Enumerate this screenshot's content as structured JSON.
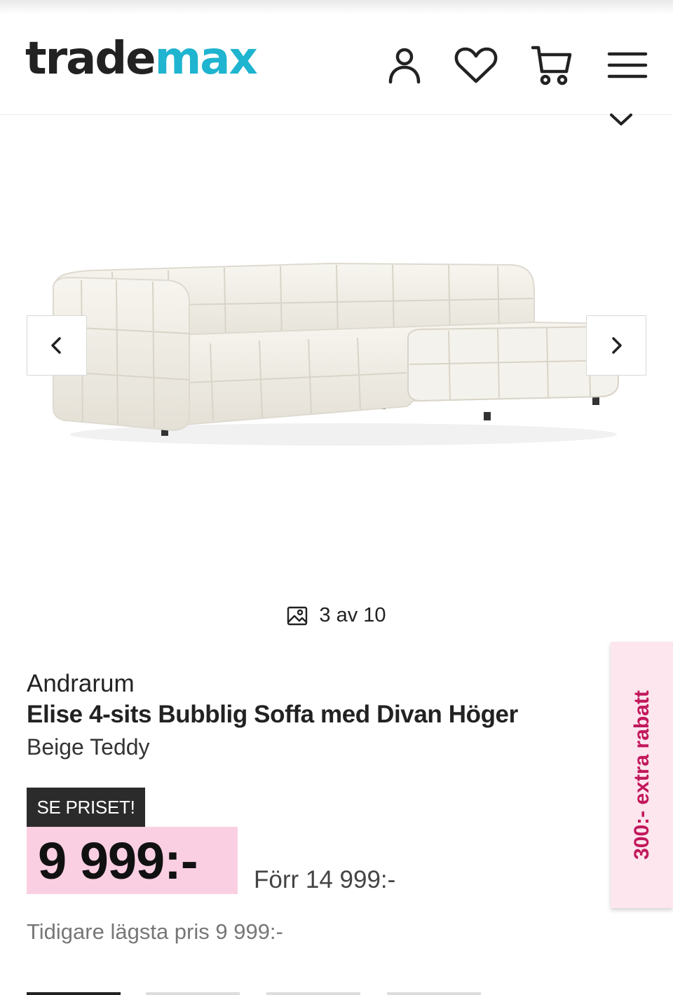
{
  "header": {
    "logo_part1": "trade",
    "logo_part2": "max",
    "icons": [
      "account-icon",
      "wishlist-heart-icon",
      "cart-icon",
      "menu-icon"
    ]
  },
  "gallery": {
    "counter": "3 av 10"
  },
  "product": {
    "brand": "Andrarum",
    "title": "Elise 4-sits Bubblig Soffa med Divan Höger",
    "variant": "Beige Teddy"
  },
  "pricing": {
    "badge": "SE PRISET!",
    "price": "9 999:-",
    "old_price": "Förr 14 999:-",
    "lowest_price": "Tidigare lägsta pris 9 999:-"
  },
  "promo": {
    "label": "300:- extra rabatt"
  },
  "colors": {
    "brand_dark": "#222222",
    "brand_accent": "#1fb4cf",
    "price_highlight": "#fbcfe2",
    "promo_bg": "#fde6ee",
    "promo_text": "#c2185b"
  }
}
